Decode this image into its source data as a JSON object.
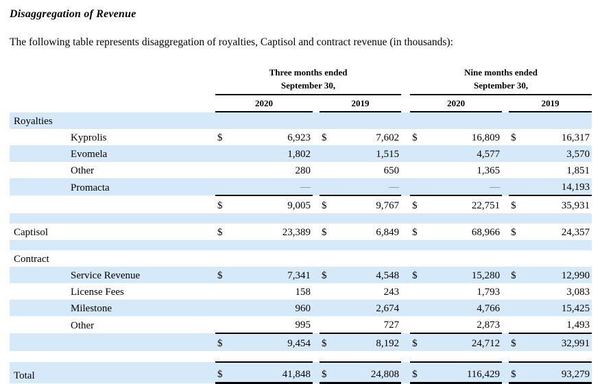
{
  "page": {
    "title": "Disaggregation of Revenue",
    "intro": "The following table represents disaggregation of royalties, Captisol and contract revenue (in thousands):"
  },
  "colors": {
    "row_shade": "#d5e9f8",
    "text": "#000000",
    "dash_gray": "#808080"
  },
  "table": {
    "col_groups": [
      {
        "label": "Three months ended",
        "sublabel": "September 30,",
        "years": [
          "2020",
          "2019"
        ]
      },
      {
        "label": "Nine months ended",
        "sublabel": "September 30,",
        "years": [
          "2020",
          "2019"
        ]
      }
    ],
    "rows": [
      {
        "type": "section",
        "label": "Royalties",
        "shaded": true
      },
      {
        "type": "item",
        "label": "Kyprolis",
        "indent": true,
        "dollar": true,
        "shaded": false,
        "values": [
          "6,923",
          "7,602",
          "16,809",
          "16,317"
        ]
      },
      {
        "type": "item",
        "label": "Evomela",
        "indent": true,
        "dollar": false,
        "shaded": true,
        "values": [
          "1,802",
          "1,515",
          "4,577",
          "3,570"
        ]
      },
      {
        "type": "item",
        "label": "Other",
        "indent": true,
        "dollar": false,
        "shaded": false,
        "values": [
          "280",
          "650",
          "1,365",
          "1,851"
        ]
      },
      {
        "type": "item",
        "label": "Promacta",
        "indent": true,
        "dollar": false,
        "shaded": true,
        "values": [
          "—",
          "—",
          "—",
          "14,193"
        ]
      },
      {
        "type": "subtotal",
        "label": "",
        "indent": false,
        "dollar": true,
        "shaded": false,
        "values": [
          "9,005",
          "9,767",
          "22,751",
          "35,931"
        ]
      },
      {
        "type": "spacer",
        "shaded": true
      },
      {
        "type": "item",
        "label": "Captisol",
        "indent": false,
        "dollar": true,
        "shaded": false,
        "values": [
          "23,389",
          "6,849",
          "68,966",
          "24,357"
        ]
      },
      {
        "type": "spacer",
        "shaded": true
      },
      {
        "type": "section",
        "label": "Contract",
        "shaded": false
      },
      {
        "type": "item",
        "label": "Service Revenue",
        "indent": true,
        "dollar": true,
        "shaded": true,
        "values": [
          "7,341",
          "4,548",
          "15,280",
          "12,990"
        ]
      },
      {
        "type": "item",
        "label": "License Fees",
        "indent": true,
        "dollar": false,
        "shaded": false,
        "values": [
          "158",
          "243",
          "1,793",
          "3,083"
        ]
      },
      {
        "type": "item",
        "label": "Milestone",
        "indent": true,
        "dollar": false,
        "shaded": true,
        "values": [
          "960",
          "2,674",
          "4,766",
          "15,425"
        ]
      },
      {
        "type": "item",
        "label": "Other",
        "indent": true,
        "dollar": false,
        "shaded": false,
        "values": [
          "995",
          "727",
          "2,873",
          "1,493"
        ]
      },
      {
        "type": "subtotal",
        "label": "",
        "indent": false,
        "dollar": true,
        "shaded": true,
        "values": [
          "9,454",
          "8,192",
          "24,712",
          "32,991"
        ]
      },
      {
        "type": "spacer",
        "shaded": false
      },
      {
        "type": "total",
        "label": "Total",
        "indent": false,
        "dollar": true,
        "shaded": true,
        "values": [
          "41,848",
          "24,808",
          "116,429",
          "93,279"
        ]
      }
    ]
  }
}
